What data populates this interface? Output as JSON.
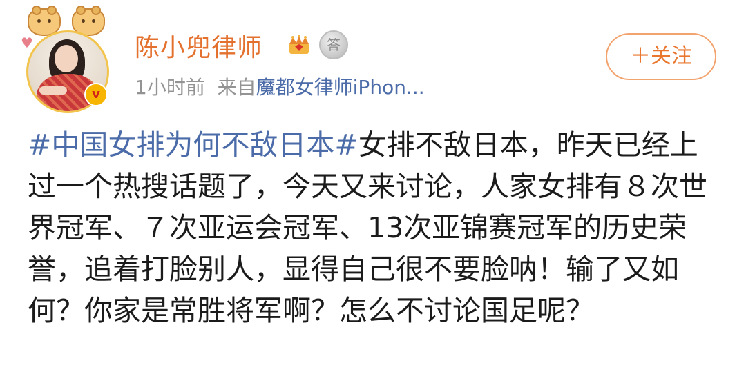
{
  "author": {
    "name": "陈小兜律师",
    "verified_mark": "v",
    "badges": [
      {
        "icon": "crown-icon",
        "color": "#e8852f"
      },
      {
        "icon": "medal-icon",
        "glyph": "答",
        "color": "#a9a9a9"
      }
    ]
  },
  "meta": {
    "time": "1小时前",
    "source_prefix": "来自",
    "source": "魔都女律师iPhon..."
  },
  "follow_button": {
    "label": "＋关注",
    "color": "#e9772f"
  },
  "post": {
    "hashtag": "#中国女排为何不敌日本#",
    "text": "女排不敌日本，昨天已经上过一个热搜话题了，今天又来讨论，人家女排有８次世界冠军、７次亚运会冠军、13次亚锦赛冠军的历史荣誉，追着打脸别人，显得自己很不要脸呐！输了又如何？你家是常胜将军啊？怎么不讨论国足呢？"
  },
  "colors": {
    "username": "#e4702d",
    "link": "#4b6ca8",
    "meta": "#939393",
    "text": "#1b1b1b"
  }
}
